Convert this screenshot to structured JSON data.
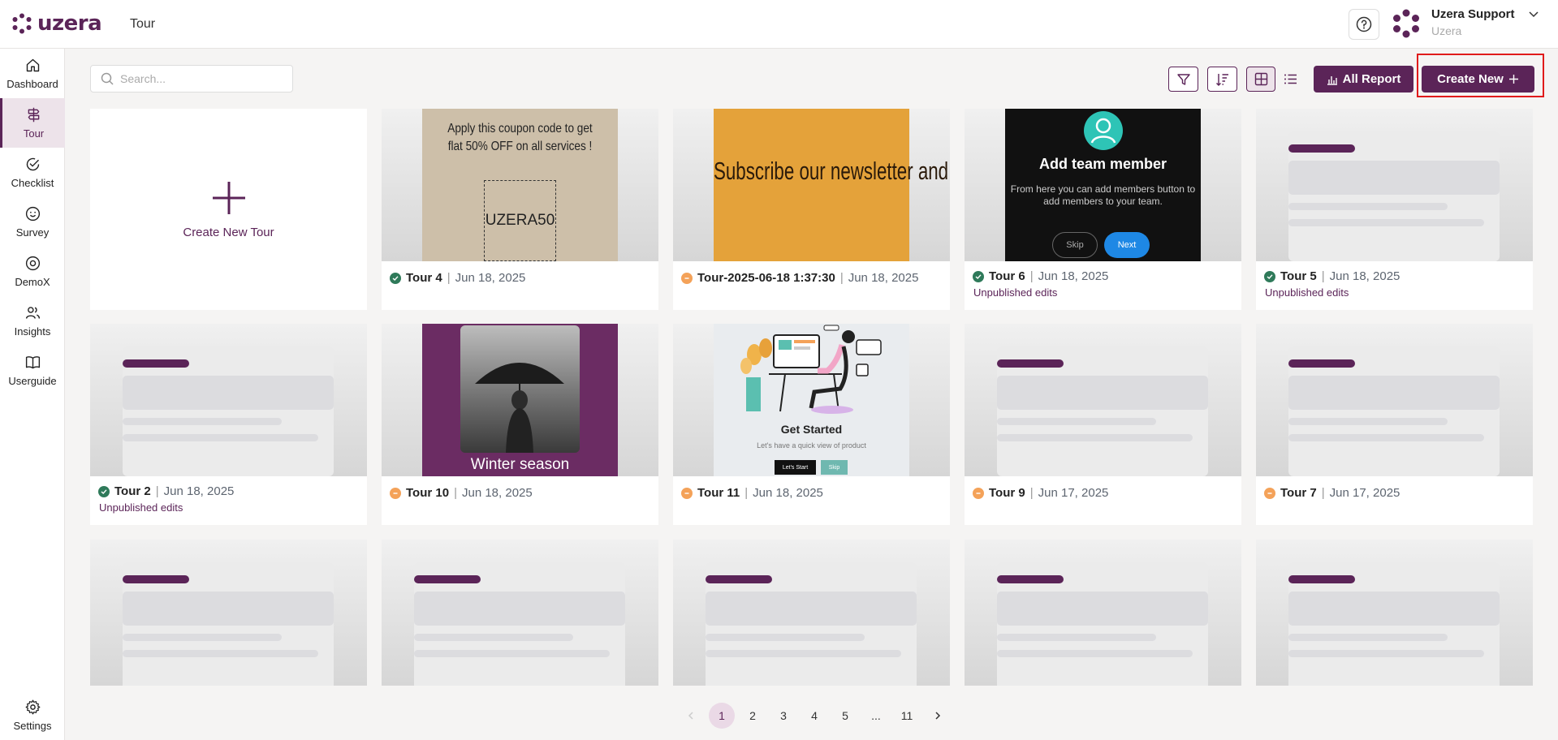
{
  "header": {
    "logo_text": "uzera",
    "page_name": "Tour",
    "help_icon": "question-circle-icon",
    "user_name": "Uzera Support",
    "user_org": "Uzera"
  },
  "sidebar": {
    "items": [
      {
        "label": "Dashboard",
        "icon": "home-icon"
      },
      {
        "label": "Tour",
        "icon": "signpost-icon",
        "active": true
      },
      {
        "label": "Checklist",
        "icon": "check-circle-icon"
      },
      {
        "label": "Survey",
        "icon": "smiley-icon"
      },
      {
        "label": "DemoX",
        "icon": "target-icon"
      },
      {
        "label": "Insights",
        "icon": "users-icon"
      },
      {
        "label": "Userguide",
        "icon": "book-icon"
      }
    ],
    "settings_label": "Settings"
  },
  "toolbar": {
    "search_placeholder": "Search...",
    "all_report_label": "All Report",
    "create_new_label": "Create New"
  },
  "create_card": {
    "label": "Create New Tour"
  },
  "tours": [
    {
      "name": "Tour 4",
      "date": "Jun 18, 2025",
      "status": "published",
      "unpublished": ""
    },
    {
      "name": "Tour-2025-06-18 1:37:30",
      "date": "Jun 18, 2025",
      "status": "draft",
      "unpublished": ""
    },
    {
      "name": "Tour 6",
      "date": "Jun 18, 2025",
      "status": "published",
      "unpublished": "Unpublished edits"
    },
    {
      "name": "Tour 5",
      "date": "Jun 18, 2025",
      "status": "published",
      "unpublished": "Unpublished edits"
    },
    {
      "name": "Tour 2",
      "date": "Jun 18, 2025",
      "status": "published",
      "unpublished": "Unpublished edits"
    },
    {
      "name": "Tour 10",
      "date": "Jun 18, 2025",
      "status": "draft",
      "unpublished": ""
    },
    {
      "name": "Tour 11",
      "date": "Jun 18, 2025",
      "status": "draft",
      "unpublished": ""
    },
    {
      "name": "Tour 9",
      "date": "Jun 17, 2025",
      "status": "draft",
      "unpublished": ""
    },
    {
      "name": "Tour 7",
      "date": "Jun 17, 2025",
      "status": "draft",
      "unpublished": ""
    }
  ],
  "thumbs": {
    "coupon": {
      "text": "Apply this coupon code to get flat 50% OFF on all services !",
      "code": "UZERA50"
    },
    "newsletter": {
      "text": "Subscribe our newsletter and get latest updates!"
    },
    "team": {
      "title": "Add team member",
      "body": "From here you can add members button to add members to your team.",
      "skip": "Skip",
      "next": "Next"
    },
    "winter": {
      "caption": "Winter season"
    },
    "started": {
      "title": "Get Started",
      "body": "Let's have a quick view of product",
      "start": "Let's Start",
      "skip": "Skip"
    }
  },
  "pagination": {
    "pages": [
      "1",
      "2",
      "3",
      "4",
      "5",
      "...",
      "11"
    ],
    "current": "1"
  },
  "colors": {
    "brand": "#5b2458",
    "published": "#2f7a5a",
    "draft": "#f4a259",
    "highlight": "#e01b1b"
  }
}
